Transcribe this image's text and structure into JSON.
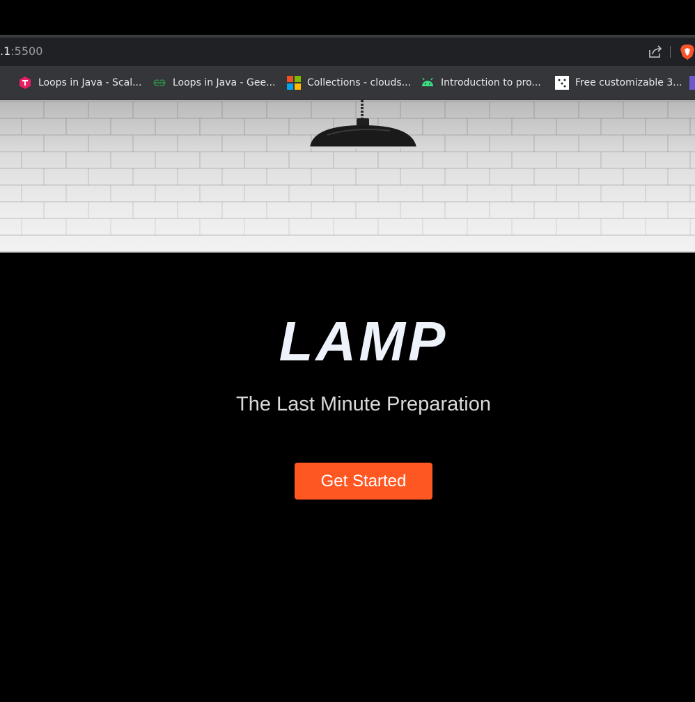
{
  "browser": {
    "url_host": ".1",
    "url_port": ":5500",
    "bookmarks": [
      {
        "label": "Loops in Java - Scal...",
        "icon": "scaler-icon",
        "color": "#e91e63"
      },
      {
        "label": "Loops in Java - Gee...",
        "icon": "geeksforgeeks-icon",
        "color": "#2f8d46"
      },
      {
        "label": "Collections - clouds...",
        "icon": "microsoft-icon",
        "color": "#f25022"
      },
      {
        "label": "Introduction to pro...",
        "icon": "android-icon",
        "color": "#3ddc84"
      },
      {
        "label": "Free customizable 3...",
        "icon": "dice-icon",
        "color": "#ffffff"
      }
    ]
  },
  "hero": {
    "title": "LAMP",
    "subtitle": "The Last Minute Preparation",
    "cta_label": "Get Started"
  },
  "colors": {
    "accent": "#ff5722",
    "background": "#000000"
  }
}
